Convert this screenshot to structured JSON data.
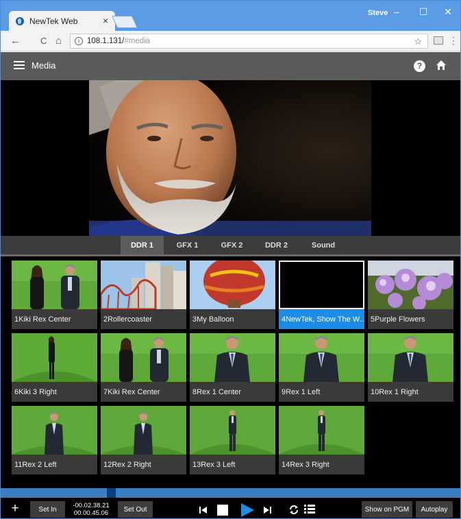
{
  "browser": {
    "tab_title": "NewTek Web",
    "tab_close": "×",
    "user_name": "Steve",
    "min": "–",
    "max": "☐",
    "close": "✕",
    "back": "←",
    "reload": "C",
    "home": "⌂",
    "info_glyph": "i",
    "url_host": "108.1.131/",
    "url_path": "#media",
    "star": "☆",
    "menu": "⋮"
  },
  "app": {
    "title": "Media",
    "help": "?"
  },
  "tabs": [
    {
      "label": "DDR 1",
      "active": true
    },
    {
      "label": "GFX 1",
      "active": false
    },
    {
      "label": "GFX 2",
      "active": false
    },
    {
      "label": "DDR 2",
      "active": false
    },
    {
      "label": "Sound",
      "active": false
    }
  ],
  "clips": [
    {
      "label": "1Kiki Rex Center",
      "thumb": "two-people-green"
    },
    {
      "label": "2Rollercoaster",
      "thumb": "rollercoaster"
    },
    {
      "label": "3My Balloon",
      "thumb": "balloon"
    },
    {
      "label": "4NewTek, Show The W...",
      "thumb": "black",
      "selected": true
    },
    {
      "label": "5Purple Flowers",
      "thumb": "flowers"
    },
    {
      "label": "6Kiki 3 Right",
      "thumb": "woman-green"
    },
    {
      "label": "7Kiki Rex Center",
      "thumb": "two-people-green"
    },
    {
      "label": "8Rex 1 Center",
      "thumb": "man-green-close"
    },
    {
      "label": "9Rex 1 Left",
      "thumb": "man-green-close"
    },
    {
      "label": "10Rex 1 Right",
      "thumb": "man-green-close"
    },
    {
      "label": "11Rex 2 Left",
      "thumb": "man-green-mid"
    },
    {
      "label": "12Rex 2 Right",
      "thumb": "man-green-mid"
    },
    {
      "label": "13Rex 3 Left",
      "thumb": "man-green-far"
    },
    {
      "label": "14Rex 3 Right",
      "thumb": "man-green-far"
    }
  ],
  "transport": {
    "add": "+",
    "set_in": "Set In",
    "timecode_remaining": "-00.02.38.21",
    "timecode_total": "00.00.45.06",
    "set_out": "Set Out",
    "show_on_pgm": "Show on PGM",
    "autoplay": "Autoplay",
    "progress": 0.24
  },
  "colors": {
    "accent": "#1c8de6",
    "appbar": "#5a5a5a",
    "chrome": "#5b9be6"
  }
}
